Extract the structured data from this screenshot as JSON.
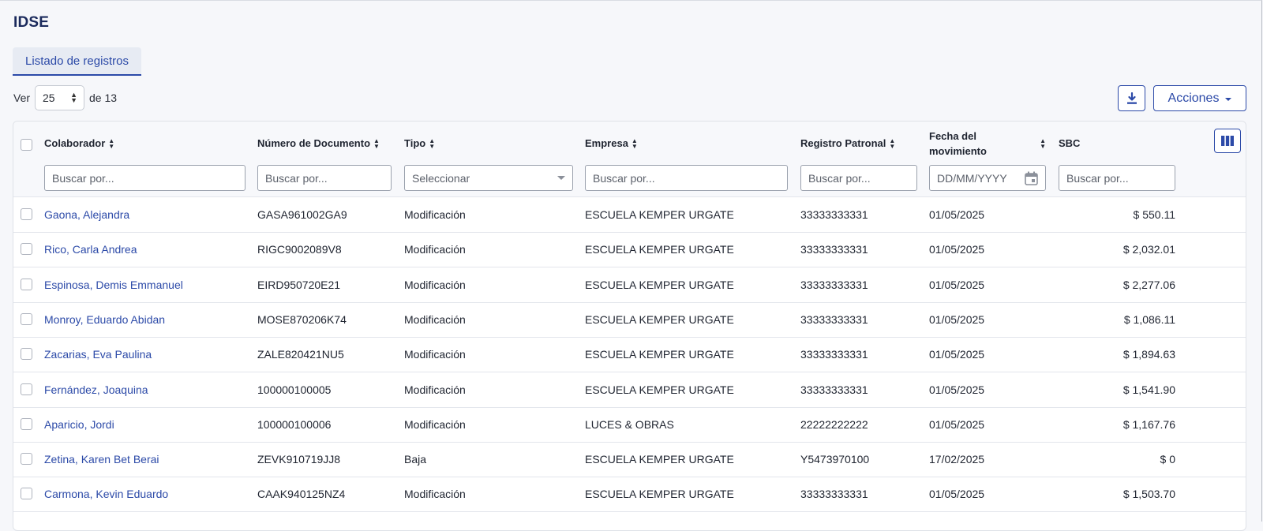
{
  "page": {
    "title": "IDSE"
  },
  "tabs": [
    {
      "label": "Listado de registros",
      "active": true
    }
  ],
  "pagination": {
    "ver_label": "Ver",
    "page_size": "25",
    "of_label": "de 13"
  },
  "toolbar": {
    "actions_label": "Acciones"
  },
  "columns": [
    {
      "key": "colaborador",
      "label": "Colaborador",
      "filter_placeholder": "Buscar por..."
    },
    {
      "key": "documento",
      "label": "Número de Documento",
      "filter_placeholder": "Buscar por..."
    },
    {
      "key": "tipo",
      "label": "Tipo",
      "filter_placeholder": "Seleccionar"
    },
    {
      "key": "empresa",
      "label": "Empresa",
      "filter_placeholder": "Buscar por..."
    },
    {
      "key": "registro",
      "label": "Registro Patronal",
      "filter_placeholder": "Buscar por..."
    },
    {
      "key": "fecha",
      "label": "Fecha del movimiento",
      "filter_placeholder": "DD/MM/YYYY"
    },
    {
      "key": "sbc",
      "label": "SBC",
      "filter_placeholder": "Buscar por..."
    }
  ],
  "rows": [
    {
      "colaborador": "Gaona, Alejandra",
      "documento": "GASA961002GA9",
      "tipo": "Modificación",
      "empresa": "ESCUELA KEMPER URGATE",
      "registro": "33333333331",
      "fecha": "01/05/2025",
      "sbc": "$ 550.11"
    },
    {
      "colaborador": "Rico, Carla Andrea",
      "documento": "RIGC9002089V8",
      "tipo": "Modificación",
      "empresa": "ESCUELA KEMPER URGATE",
      "registro": "33333333331",
      "fecha": "01/05/2025",
      "sbc": "$ 2,032.01"
    },
    {
      "colaborador": "Espinosa, Demis Emmanuel",
      "documento": "EIRD950720E21",
      "tipo": "Modificación",
      "empresa": "ESCUELA KEMPER URGATE",
      "registro": "33333333331",
      "fecha": "01/05/2025",
      "sbc": "$ 2,277.06"
    },
    {
      "colaborador": "Monroy, Eduardo Abidan",
      "documento": "MOSE870206K74",
      "tipo": "Modificación",
      "empresa": "ESCUELA KEMPER URGATE",
      "registro": "33333333331",
      "fecha": "01/05/2025",
      "sbc": "$ 1,086.11"
    },
    {
      "colaborador": "Zacarias, Eva Paulina",
      "documento": "ZALE820421NU5",
      "tipo": "Modificación",
      "empresa": "ESCUELA KEMPER URGATE",
      "registro": "33333333331",
      "fecha": "01/05/2025",
      "sbc": "$ 1,894.63"
    },
    {
      "colaborador": "Fernández, Joaquina",
      "documento": "100000100005",
      "tipo": "Modificación",
      "empresa": "ESCUELA KEMPER URGATE",
      "registro": "33333333331",
      "fecha": "01/05/2025",
      "sbc": "$ 1,541.90"
    },
    {
      "colaborador": "Aparicio, Jordi",
      "documento": "100000100006",
      "tipo": "Modificación",
      "empresa": "LUCES & OBRAS",
      "registro": "22222222222",
      "fecha": "01/05/2025",
      "sbc": "$ 1,167.76"
    },
    {
      "colaborador": "Zetina, Karen Bet Berai",
      "documento": "ZEVK910719JJ8",
      "tipo": "Baja",
      "empresa": "ESCUELA KEMPER URGATE",
      "registro": "Y5473970100",
      "fecha": "17/02/2025",
      "sbc": "$ 0"
    },
    {
      "colaborador": "Carmona, Kevin Eduardo",
      "documento": "CAAK940125NZ4",
      "tipo": "Modificación",
      "empresa": "ESCUELA KEMPER URGATE",
      "registro": "33333333331",
      "fecha": "01/05/2025",
      "sbc": "$ 1,503.70"
    }
  ],
  "icons": {
    "download": "download-icon",
    "columns": "columns-icon",
    "calendar": "calendar-icon",
    "sort": "sort-icon"
  },
  "colors": {
    "accent": "#2c4aa8",
    "title": "#1b2a5c",
    "link": "#2c4aa8"
  }
}
